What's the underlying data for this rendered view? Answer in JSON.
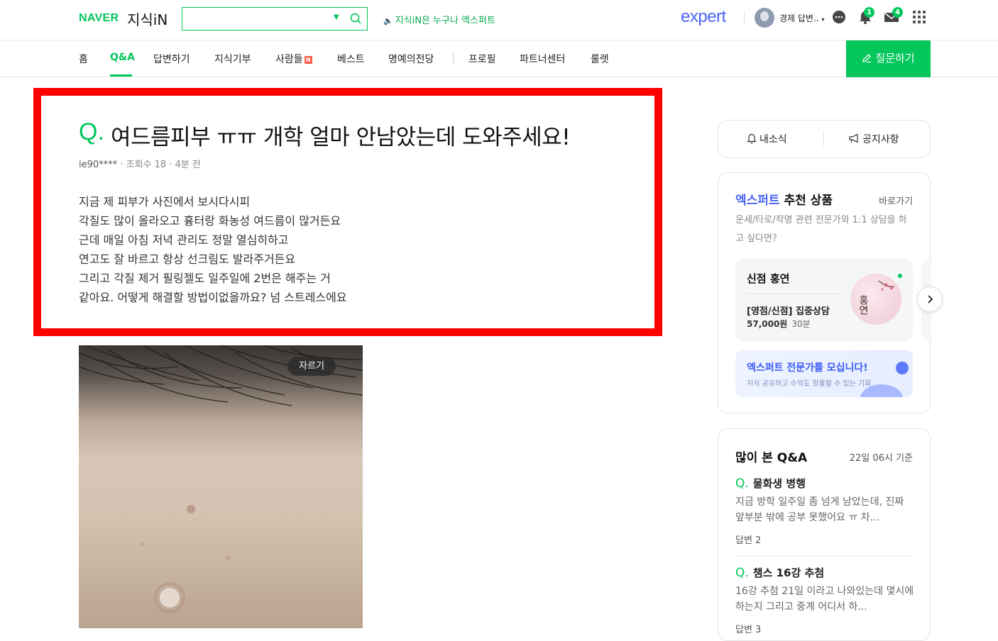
{
  "header": {
    "brand": "NAVER",
    "service": "지식iN",
    "search": {
      "value": "",
      "placeholder": ""
    },
    "notice": "지식iN은 누구나 엑스퍼트",
    "expert_logo": "expert",
    "user_name": "경제 답변..",
    "alarm_count": "1",
    "mail_count": "4",
    "icons": [
      "search-icon",
      "speaker-icon",
      "chat-icon",
      "bell-icon",
      "mail-icon",
      "grid-menu-icon"
    ]
  },
  "nav": {
    "items": [
      "홈",
      "Q&A",
      "답변하기",
      "지식기부",
      "사람들",
      "베스트",
      "명예의전당",
      "프로필",
      "파트너센터",
      "룰렛"
    ],
    "active": "Q&A",
    "new_badge": "N",
    "ask_button": "질문하기"
  },
  "question": {
    "q_mark": "Q.",
    "title": "여드름피부 ㅠㅠ 개학 얼마 안남았는데 도와주세요!",
    "author": "ie90****",
    "views": "조회수 18",
    "time": "4분 전",
    "body": [
      "지금 제 피부가 사진에서 보시다시피",
      "각질도 많이 올라오고 흉터랑 화농성 여드름이 많거든요",
      "근데 매일 아침 저녁 관리도 정말 열심히하고",
      "연고도 잘 바르고 항상 선크림도 발라주거든요",
      "그리고 각질 제거 필링젤도 일주일에 2번은 해주는 거",
      "같아요. 어떻게 해결할 방법이없을까요? 넘 스트레스에요"
    ],
    "crop_button": "자르기"
  },
  "sidebar": {
    "news": [
      "내소식",
      "공지사항"
    ],
    "expert": {
      "title_brand": "엑스퍼트",
      "title_rest": " 추천 상품",
      "link": "바로가기",
      "desc": "운세/타로/작명 관련 전문가와 1:1 상담을 하고 싶다면?",
      "product": {
        "name": "신점 홍연",
        "title": "[영점/신점] 집중상담",
        "price": "57,000원",
        "duration": "30분",
        "image_text": "홍연"
      },
      "recruit_title": "엑스퍼트 전문가를 모십니다!",
      "recruit_sub": "지식 공유하고 수익도 창출할 수 있는 기회"
    },
    "popular": {
      "title": "많이 본 Q&A",
      "time": "22일 06시 기준",
      "items": [
        {
          "q": "물화생 병행",
          "body": "지금 방학 일주일 좀 넘게 남았는데, 진짜 앞부분 밖에 공부 못했어요 ㅠ 차...",
          "answers": "답변 2"
        },
        {
          "q": "챔스 16강 추첨",
          "body": "16강 추첨 21일 이라고 나와있는데 몇시에하는지 그리고 중계 어디서 하...",
          "answers": "답변 3"
        }
      ]
    }
  },
  "colors": {
    "brand_green": "#03c75a",
    "highlight_red": "#ff0000",
    "expert_blue": "#4b65f6"
  }
}
